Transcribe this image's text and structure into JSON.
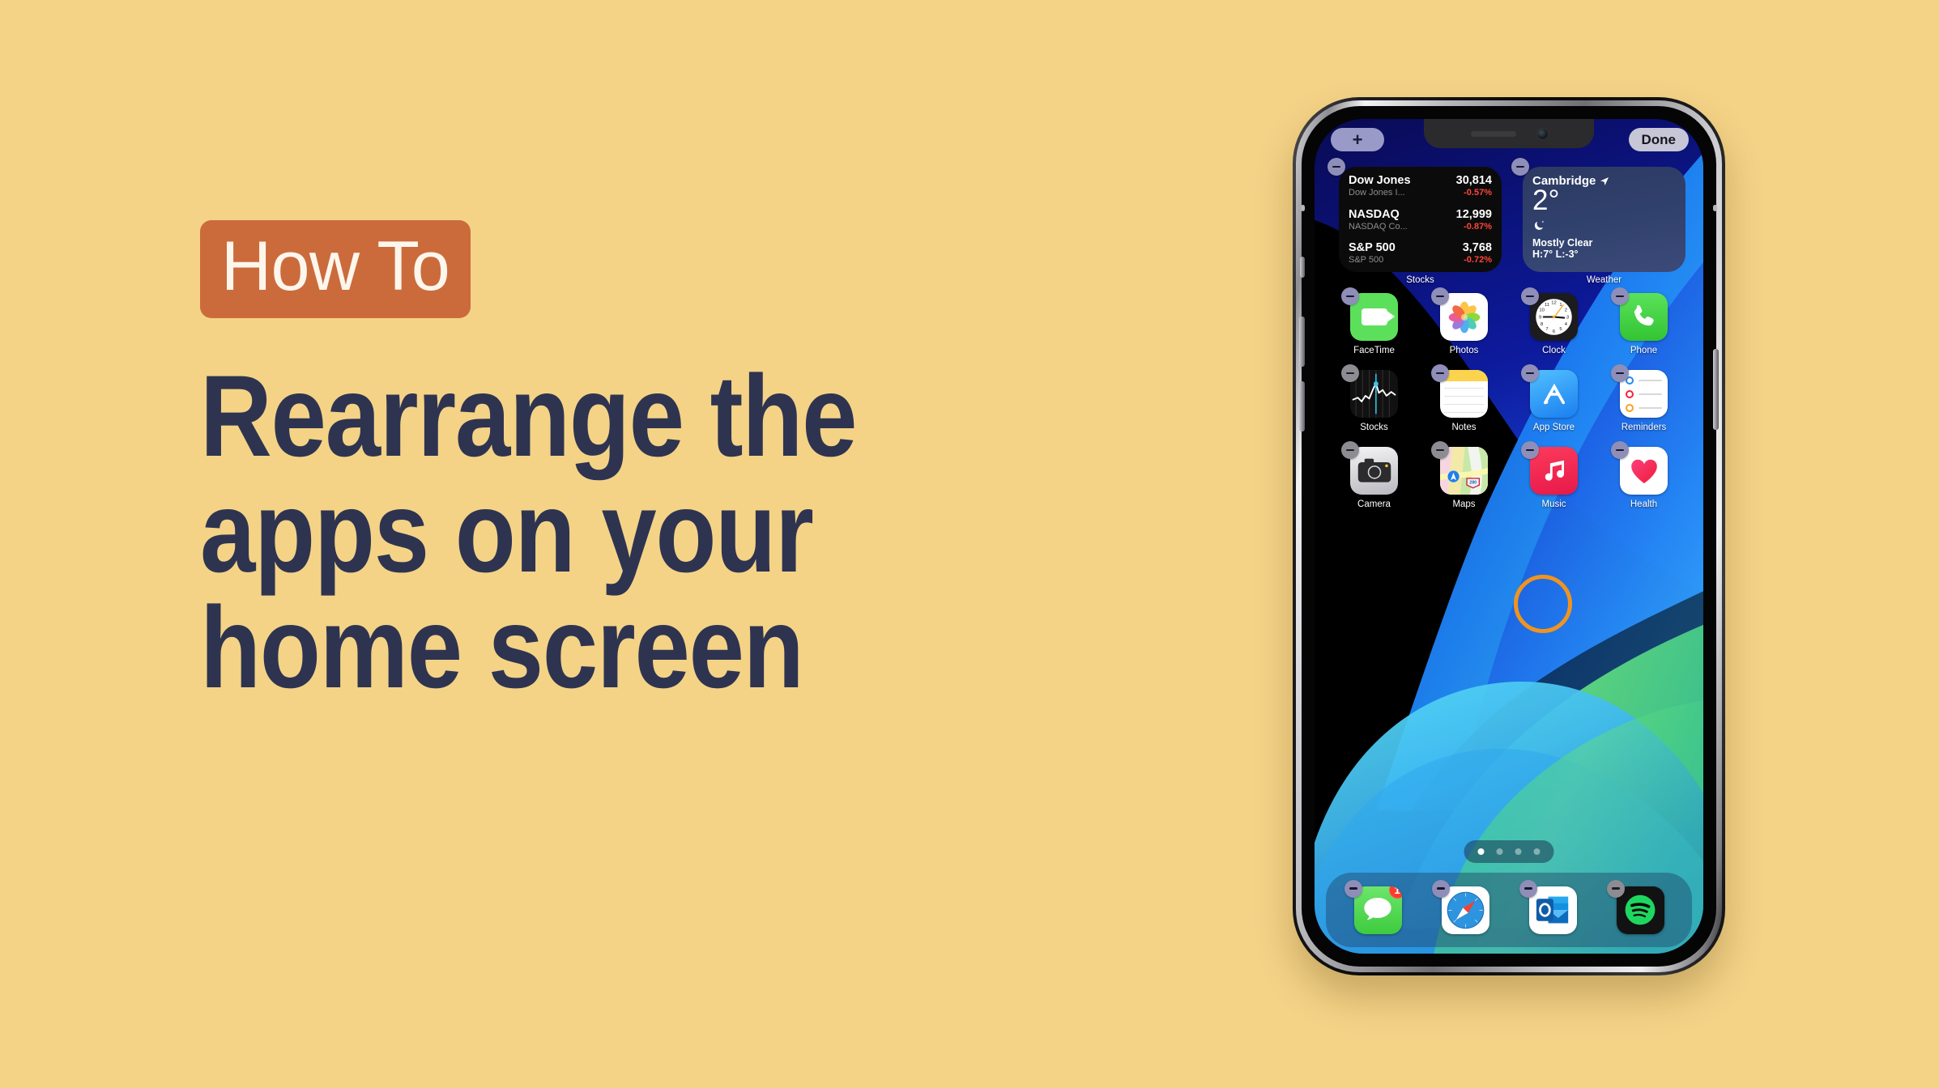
{
  "page": {
    "background_color": "#f4d387",
    "badge_color": "#cb6b3c",
    "headline_color": "#2e3450"
  },
  "left": {
    "badge_label": "How To",
    "headline": "Rearrange the\napps on your\nhome screen"
  },
  "phone": {
    "topbar": {
      "add_label": "+",
      "done_label": "Done"
    },
    "widgets": [
      {
        "name": "Stocks",
        "label": "Stocks",
        "rows": [
          {
            "name": "Dow Jones",
            "value": "30,814",
            "desc": "Dow Jones I...",
            "change": "-0.57%"
          },
          {
            "name": "NASDAQ",
            "value": "12,999",
            "desc": "NASDAQ Co...",
            "change": "-0.87%"
          },
          {
            "name": "S&P 500",
            "value": "3,768",
            "desc": "S&P 500",
            "change": "-0.72%"
          }
        ]
      },
      {
        "name": "Weather",
        "label": "Weather",
        "city": "Cambridge",
        "temp": "2°",
        "condition": "Mostly Clear",
        "high_low": "H:7° L:-3°",
        "icon": "moon-stars-icon"
      }
    ],
    "grid_rows": [
      [
        {
          "label": "FaceTime",
          "icon": "facetime-icon"
        },
        {
          "label": "Photos",
          "icon": "photos-icon"
        },
        {
          "label": "Clock",
          "icon": "clock-icon"
        },
        {
          "label": "Phone",
          "icon": "phone-icon"
        }
      ],
      [
        {
          "label": "Stocks",
          "icon": "stocks-icon"
        },
        {
          "label": "Notes",
          "icon": "notes-icon"
        },
        {
          "label": "App Store",
          "icon": "app-store-icon"
        },
        {
          "label": "Reminders",
          "icon": "reminders-icon"
        }
      ],
      [
        {
          "label": "Camera",
          "icon": "camera-icon"
        },
        {
          "label": "Maps",
          "icon": "maps-icon"
        },
        {
          "label": "Music",
          "icon": "music-icon"
        },
        {
          "label": "Health",
          "icon": "health-icon"
        }
      ]
    ],
    "maps_shield_number": "280",
    "clock_numerals": [
      "12",
      "1",
      "2",
      "3",
      "4",
      "5",
      "6",
      "7",
      "8",
      "9",
      "10",
      "11"
    ],
    "dock": [
      {
        "label": "Messages",
        "icon": "messages-icon",
        "badge": "1"
      },
      {
        "label": "Safari",
        "icon": "safari-icon",
        "badge": ""
      },
      {
        "label": "Outlook",
        "icon": "outlook-icon",
        "badge": ""
      },
      {
        "label": "Spotify",
        "icon": "spotify-icon",
        "badge": ""
      }
    ],
    "page_dots": {
      "total": 4,
      "active": 1
    },
    "remove_button_icon": "minus-circle-icon",
    "cursor_icon": "tap-highlight-ring"
  }
}
